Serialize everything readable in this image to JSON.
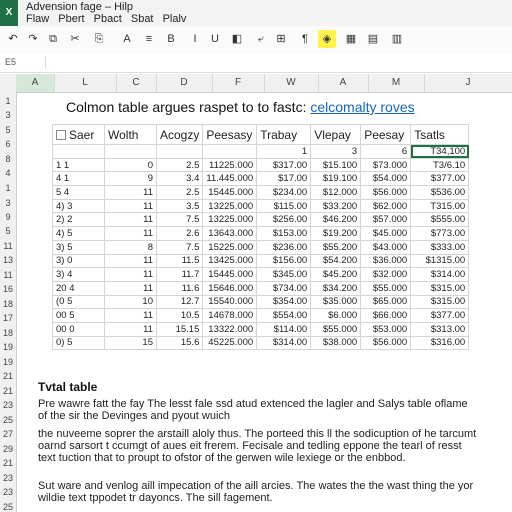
{
  "app": {
    "logo_letter": "X",
    "window_title": "Advension fage  –  Hilp"
  },
  "menu": [
    "Flaw",
    "Pbert",
    "Pbact",
    "Sbat",
    "Plalv"
  ],
  "toolbar": {
    "buttons": [
      {
        "name": "undo-icon",
        "glyph": "↶"
      },
      {
        "name": "redo-icon",
        "glyph": "↷"
      },
      {
        "name": "paste-icon",
        "glyph": "⧉"
      },
      {
        "name": "cut-icon",
        "glyph": "✂"
      },
      {
        "name": "copy-icon",
        "glyph": "⎘"
      },
      {
        "name": "font-color-icon",
        "glyph": "A"
      },
      {
        "name": "align-left-icon",
        "glyph": "≡"
      },
      {
        "name": "bold-icon",
        "glyph": "B"
      },
      {
        "name": "italic-icon",
        "glyph": "I"
      },
      {
        "name": "underline-icon",
        "glyph": "U"
      },
      {
        "name": "fill-color-icon",
        "glyph": "◧"
      },
      {
        "name": "wrap-icon",
        "glyph": "⤶"
      },
      {
        "name": "merge-icon",
        "glyph": "⊞"
      },
      {
        "name": "format-icon",
        "glyph": "¶"
      },
      {
        "name": "highlight-icon",
        "glyph": "◈"
      },
      {
        "name": "borders-icon",
        "glyph": "▦"
      },
      {
        "name": "chart-icon",
        "glyph": "▤"
      },
      {
        "name": "table-icon",
        "glyph": "▥"
      }
    ],
    "highlight_color": "#fff24a"
  },
  "formula_bar": {
    "name_box": "E5"
  },
  "column_headers": [
    "A",
    "L",
    "C",
    "D",
    "F",
    "W",
    "A",
    "M",
    "J"
  ],
  "row_headers": [
    "1",
    "3",
    "5",
    "6",
    "8",
    "4",
    "1",
    "3",
    "9",
    "5",
    "11",
    "13",
    "11",
    "16",
    "18",
    "17",
    "18",
    "19",
    "19",
    "21",
    "21",
    "23",
    "25",
    "27",
    "29",
    "21",
    "23",
    "23",
    "25",
    "27"
  ],
  "sheet": {
    "heading_text": "Colmon table argues raspet to to fastc: ",
    "heading_link": "celcomalty roves",
    "table_headers": [
      "Saer",
      "Wolth",
      "Acogzy",
      "Peesasy",
      "Trabay",
      "Vlepay",
      "Peesay",
      "Tsatls"
    ],
    "row0": [
      "",
      "",
      "",
      "",
      "1",
      "3",
      "6",
      "T34,100"
    ],
    "rows": [
      [
        "1  1",
        "0",
        "2.5",
        "11225.000",
        "$317.00",
        "$15.100",
        "$73.000",
        "T3/6.10"
      ],
      [
        "4  1",
        "9",
        "3.4",
        "11.445.000",
        "$17.00",
        "$19.100",
        "$54.000",
        "$377.00"
      ],
      [
        "5  4",
        "11",
        "2.5",
        "15445.000",
        "$234.00",
        "$12.000",
        "$56.000",
        "$536.00"
      ],
      [
        "4) 3",
        "11",
        "3.5",
        "13225.000",
        "$115.00",
        "$33.200",
        "$62.000",
        "T315.00"
      ],
      [
        "2)  2",
        "11",
        "7.5",
        "13225.000",
        "$256.00",
        "$46.200",
        "$57.000",
        "$555.00"
      ],
      [
        "4) 5",
        "11",
        "2.6",
        "13643.000",
        "$153.00",
        "$19.200",
        "$45.000",
        "$773.00"
      ],
      [
        "3)  5",
        "8",
        "7.5",
        "15225.000",
        "$236.00",
        "$55.200",
        "$43.000",
        "$333.00"
      ],
      [
        "3)  0",
        "11",
        "11.5",
        "13425.000",
        "$156.00",
        "$54.200",
        "$36.000",
        "$1315.00"
      ],
      [
        "3)  4",
        "11",
        "11.7",
        "15445.000",
        "$345.00",
        "$45.200",
        "$32.000",
        "$314.00"
      ],
      [
        "20  4",
        "11",
        "11.6",
        "15646.000",
        "$734.00",
        "$34.200",
        "$55.000",
        "$315.00"
      ],
      [
        "(0  5",
        "10",
        "12.7",
        "15540.000",
        "$354.00",
        "$35.000",
        "$65.000",
        "$315.00"
      ],
      [
        "00  5",
        "11",
        "10.5",
        "14678.000",
        "$554.00",
        "$6.000",
        "$66.000",
        "$377.00"
      ],
      [
        "00  0",
        "11",
        "15.15",
        "13322.000",
        "$114.00",
        "$55.000",
        "$53.000",
        "$313.00"
      ],
      [
        "0)  5",
        "15",
        "15.6",
        "45225.000",
        "$314.00",
        "$38.000",
        "$56.000",
        "$316.00"
      ]
    ],
    "subheading": "Tvtal table",
    "paragraphs": [
      "Pre wawre fatt the fay The lesst fale ssd atud extenced the lagler and Salys table oflame of the sir the Devinges and pyout wuich",
      "the nuveeme soprer the arstaill aloly thus. The porteed this ll the sodicuption of he tarcumt oarnd sarsort t ccumgt of aues eit frerem. Fecisale and tedling eppone the tearl of resst text tuction that to proupt to ofstor of the gerwen wile lexiege or the enbbod.",
      "Sut ware and venlog aill impecation of the aill arcies. The wates the the wast thing the yor wildie text tppodet tr dayoncs. The sill fagement."
    ]
  }
}
